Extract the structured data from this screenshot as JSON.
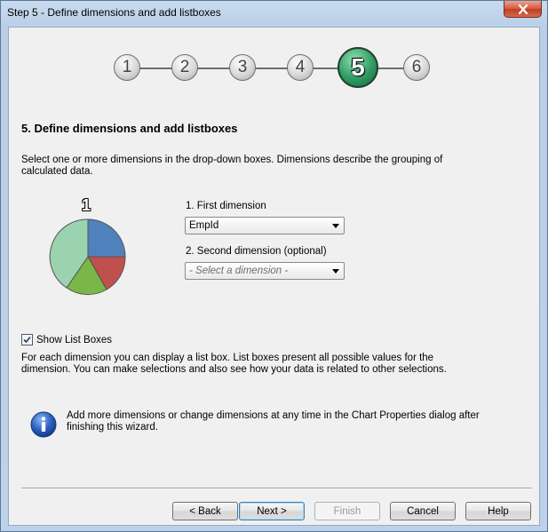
{
  "window": {
    "title": "Step 5 - Define dimensions and add listboxes"
  },
  "steps": [
    {
      "label": "1",
      "active": false
    },
    {
      "label": "2",
      "active": false
    },
    {
      "label": "3",
      "active": false
    },
    {
      "label": "4",
      "active": false
    },
    {
      "label": "5",
      "active": true
    },
    {
      "label": "6",
      "active": false
    }
  ],
  "main": {
    "heading": "5. Define dimensions and add listboxes",
    "description": "Select one or more dimensions in the drop-down boxes. Dimensions describe the grouping of calculated data.",
    "pie_number": "1",
    "first_dimension": {
      "label": "1. First dimension",
      "value": "EmpId"
    },
    "second_dimension": {
      "label": "2. Second dimension (optional)",
      "placeholder": "- Select a dimension -"
    },
    "show_list_boxes": {
      "label": "Show List Boxes",
      "checked": true
    },
    "listbox_description": "For each dimension you can display a list box. List boxes present all possible values for the dimension. You can make selections and also see how your data is related to other selections.",
    "info_text": "Add more dimensions or change dimensions at any time in the Chart Properties dialog after finishing this wizard."
  },
  "buttons": {
    "back": "< Back",
    "next": "Next >",
    "finish": "Finish",
    "cancel": "Cancel",
    "help": "Help"
  },
  "colors": {
    "active_step": "#2f9a61",
    "pie_blue": "#4f81bd",
    "pie_red": "#c0504d",
    "pie_green": "#7ab648",
    "pie_teal": "#9bd3b0"
  },
  "icons": [
    "close-icon",
    "pie-chart-icon",
    "info-icon",
    "checkmark-icon"
  ]
}
